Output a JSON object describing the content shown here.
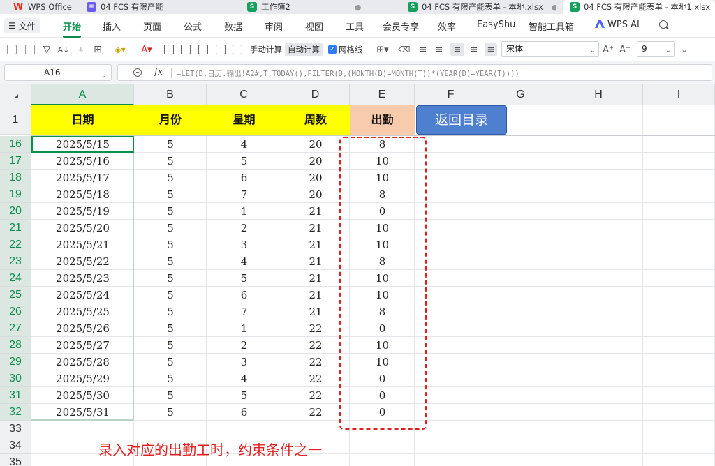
{
  "tabs": [
    {
      "label": "WPS Office",
      "icon": "wps-logo-icon"
    },
    {
      "label": "04 FCS 有限产能",
      "icon": "document-icon"
    },
    {
      "label": "工作簿2",
      "icon": "spreadsheet-icon"
    },
    {
      "label": "04 FCS 有限产能表单 - 本地.xlsx",
      "icon": "spreadsheet-icon"
    },
    {
      "label": "04 FCS 有限产能表单 - 本地1.xlsx",
      "icon": "spreadsheet-icon"
    }
  ],
  "menu": {
    "file_label": "文件",
    "items": [
      "开始",
      "插入",
      "页面",
      "公式",
      "数据",
      "审阅",
      "视图",
      "工具",
      "会员专享",
      "效率",
      "EasyShu",
      "智能工具箱",
      "WPS AI"
    ],
    "active": "开始"
  },
  "toolbar": {
    "manual_calc": "手动计算",
    "auto_calc": "自动计算",
    "gridlines": "网格线",
    "font_name": "宋体",
    "font_size": "9"
  },
  "formula_bar": {
    "cell_ref": "A16",
    "fx_label": "fx",
    "formula": "=LET(D,日历.输出!A2#,T,TODAY(),FILTER(D,(MONTH(D)=MONTH(T))*(YEAR(D)=YEAR(T))))"
  },
  "grid": {
    "columns": [
      "A",
      "B",
      "C",
      "D",
      "E",
      "F",
      "G",
      "H",
      "I"
    ],
    "selected_column": "A",
    "header_row_number": "1",
    "headers": {
      "A": "日期",
      "B": "月份",
      "C": "星期",
      "D": "周数",
      "E": "出勤"
    },
    "back_button": "返回目录",
    "rows": [
      {
        "n": "16",
        "date": "2025/5/15",
        "month": "5",
        "weekday": "4",
        "week": "20",
        "attendance": "8"
      },
      {
        "n": "17",
        "date": "2025/5/16",
        "month": "5",
        "weekday": "5",
        "week": "20",
        "attendance": "10"
      },
      {
        "n": "18",
        "date": "2025/5/17",
        "month": "5",
        "weekday": "6",
        "week": "20",
        "attendance": "10"
      },
      {
        "n": "19",
        "date": "2025/5/18",
        "month": "5",
        "weekday": "7",
        "week": "20",
        "attendance": "8"
      },
      {
        "n": "20",
        "date": "2025/5/19",
        "month": "5",
        "weekday": "1",
        "week": "21",
        "attendance": "0"
      },
      {
        "n": "21",
        "date": "2025/5/20",
        "month": "5",
        "weekday": "2",
        "week": "21",
        "attendance": "10"
      },
      {
        "n": "22",
        "date": "2025/5/21",
        "month": "5",
        "weekday": "3",
        "week": "21",
        "attendance": "10"
      },
      {
        "n": "23",
        "date": "2025/5/22",
        "month": "5",
        "weekday": "4",
        "week": "21",
        "attendance": "8"
      },
      {
        "n": "24",
        "date": "2025/5/23",
        "month": "5",
        "weekday": "5",
        "week": "21",
        "attendance": "10"
      },
      {
        "n": "25",
        "date": "2025/5/24",
        "month": "5",
        "weekday": "6",
        "week": "21",
        "attendance": "10"
      },
      {
        "n": "26",
        "date": "2025/5/25",
        "month": "5",
        "weekday": "7",
        "week": "21",
        "attendance": "8"
      },
      {
        "n": "27",
        "date": "2025/5/26",
        "month": "5",
        "weekday": "1",
        "week": "22",
        "attendance": "0"
      },
      {
        "n": "28",
        "date": "2025/5/27",
        "month": "5",
        "weekday": "2",
        "week": "22",
        "attendance": "10"
      },
      {
        "n": "29",
        "date": "2025/5/28",
        "month": "5",
        "weekday": "3",
        "week": "22",
        "attendance": "10"
      },
      {
        "n": "30",
        "date": "2025/5/29",
        "month": "5",
        "weekday": "4",
        "week": "22",
        "attendance": "0"
      },
      {
        "n": "31",
        "date": "2025/5/30",
        "month": "5",
        "weekday": "5",
        "week": "22",
        "attendance": "0"
      },
      {
        "n": "32",
        "date": "2025/5/31",
        "month": "5",
        "weekday": "6",
        "week": "22",
        "attendance": "0"
      }
    ],
    "empty_rows": [
      "33",
      "34",
      "35"
    ]
  },
  "annotation": "录入对应的出勤工时，约束条件之一",
  "colors": {
    "accent_green": "#0a8e4d",
    "header_yellow": "#ffff00",
    "header_peach": "#f8cbad",
    "button_blue": "#4f7fcf",
    "annotation_red": "#e02020"
  }
}
